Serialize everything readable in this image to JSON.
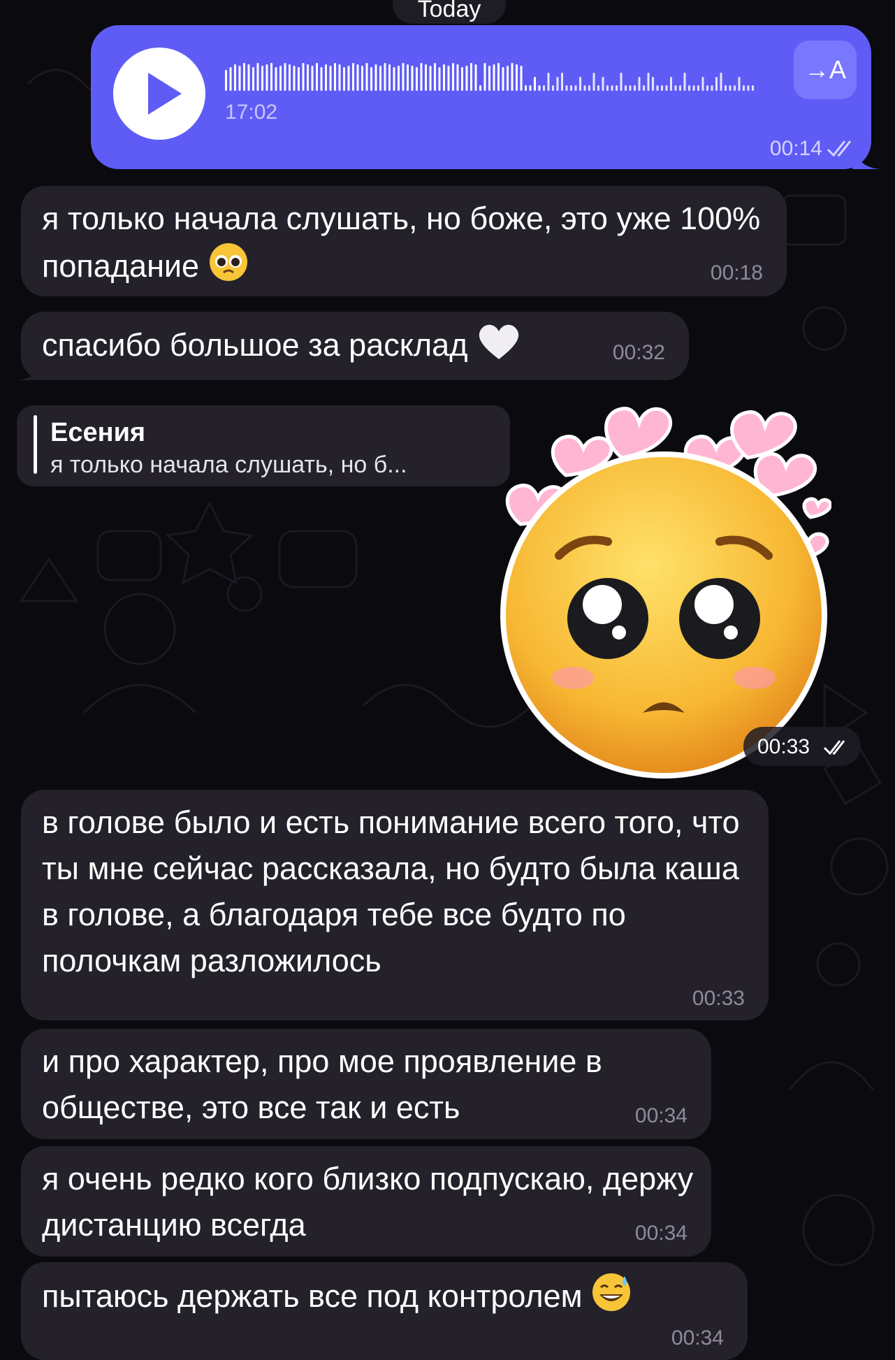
{
  "date_separator": "Today",
  "voice_message": {
    "duration": "17:02",
    "transcribe_label": "→A",
    "time": "00:14"
  },
  "messages": [
    {
      "text": "я только начала слушать, но боже, это уже 100% попадание",
      "emoji": "pleading-face-emoji",
      "time": "00:18"
    },
    {
      "text": "спасибо большое за расклад",
      "emoji": "white-heart-emoji",
      "time": "00:32"
    },
    {
      "text": "в голове было и есть понимание всего того, что ты мне сейчас рассказала, но будто была каша в голове, а благодаря тебе все будто по полочкам разложилось",
      "time": "00:33"
    },
    {
      "text": "и про характер, про мое проявление в обществе, это все так и есть",
      "time": "00:34"
    },
    {
      "text": "я очень редко кого близко подпускаю, держу дистанцию всегда",
      "time": "00:34"
    },
    {
      "text": "пытаюсь держать все под контролем",
      "emoji": "grinning-sweat-emoji",
      "time": "00:34"
    }
  ],
  "reply": {
    "name": "Есения",
    "quote": "я только начала слушать, но б..."
  },
  "sticker": {
    "name": "pleading-face-hearts-sticker",
    "time": "00:33"
  },
  "colors": {
    "outgoing": "#5f5cf6",
    "incoming": "#24212b",
    "background": "#0b0a0e"
  }
}
